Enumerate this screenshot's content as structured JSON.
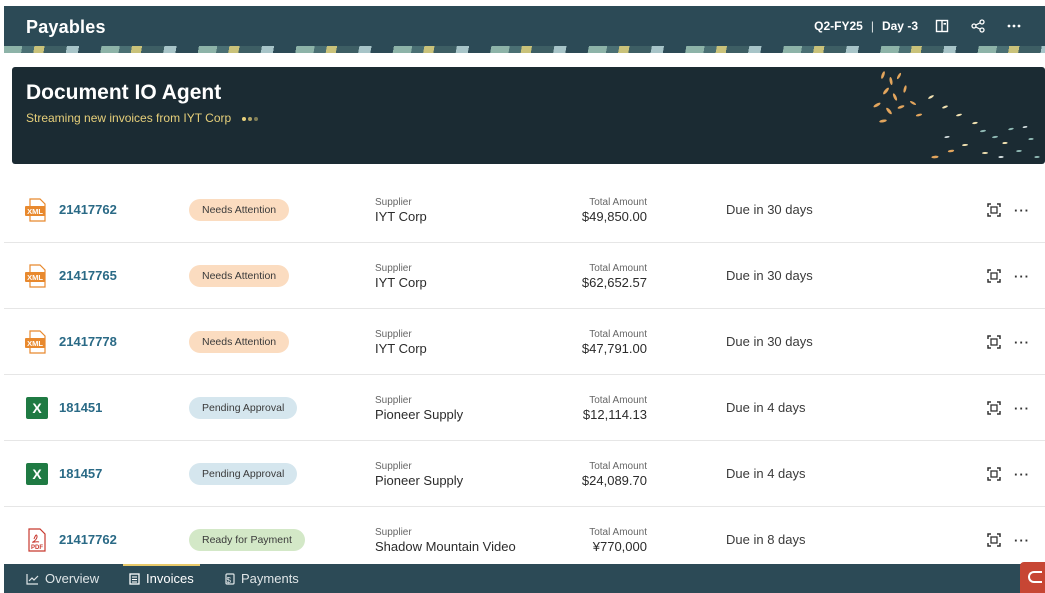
{
  "header": {
    "title": "Payables",
    "period": "Q2-FY25",
    "separator": "|",
    "day": "Day -3",
    "icons": [
      "panel-icon",
      "share-icon",
      "more-icon"
    ],
    "bg_color": "#2c4a56"
  },
  "banner": {
    "title": "Document IO Agent",
    "subtitle": "Streaming new invoices from IYT Corp",
    "accent_color": "#e6cf7a"
  },
  "invoices": [
    {
      "file_type": "XML",
      "number": "21417762",
      "status": "Needs Attention",
      "status_kind": "attn",
      "supplier_label": "Supplier",
      "supplier": "IYT Corp",
      "amount_label": "Total Amount",
      "amount": "$49,850.00",
      "due": "Due in 30 days"
    },
    {
      "file_type": "XML",
      "number": "21417765",
      "status": "Needs Attention",
      "status_kind": "attn",
      "supplier_label": "Supplier",
      "supplier": "IYT Corp",
      "amount_label": "Total Amount",
      "amount": "$62,652.57",
      "due": "Due in 30 days"
    },
    {
      "file_type": "XML",
      "number": "21417778",
      "status": "Needs Attention",
      "status_kind": "attn",
      "supplier_label": "Supplier",
      "supplier": "IYT Corp",
      "amount_label": "Total Amount",
      "amount": "$47,791.00",
      "due": "Due in 30 days"
    },
    {
      "file_type": "X",
      "number": "181451",
      "status": "Pending Approval",
      "status_kind": "pend",
      "supplier_label": "Supplier",
      "supplier": "Pioneer Supply",
      "amount_label": "Total Amount",
      "amount": "$12,114.13",
      "due": "Due in 4 days"
    },
    {
      "file_type": "X",
      "number": "181457",
      "status": "Pending Approval",
      "status_kind": "pend",
      "supplier_label": "Supplier",
      "supplier": "Pioneer Supply",
      "amount_label": "Total Amount",
      "amount": "$24,089.70",
      "due": "Due in 4 days"
    },
    {
      "file_type": "PDF",
      "number": "21417762",
      "status": "Ready for Payment",
      "status_kind": "ready",
      "supplier_label": "Supplier",
      "supplier": "Shadow Mountain Video",
      "amount_label": "Total Amount",
      "amount": "¥770,000",
      "due": "Due in 8 days"
    }
  ],
  "row_actions": {
    "icons": [
      "scan-icon",
      "more-icon"
    ],
    "more_glyph": "···"
  },
  "bottom_nav": {
    "tabs": [
      {
        "label": "Overview",
        "icon": "chart-icon",
        "active": false
      },
      {
        "label": "Invoices",
        "icon": "document-icon",
        "active": true
      },
      {
        "label": "Payments",
        "icon": "payment-icon",
        "active": false
      }
    ]
  },
  "colors": {
    "link": "#2a6a86",
    "needs_attention": "#fbdcc0",
    "pending_approval": "#d5e6ee",
    "ready_for_payment": "#d3e8c7",
    "xml_icon": "#e8892e",
    "excel_icon": "#1f7a43",
    "pdf_icon": "#c8392f",
    "brand_red": "#c74634"
  }
}
